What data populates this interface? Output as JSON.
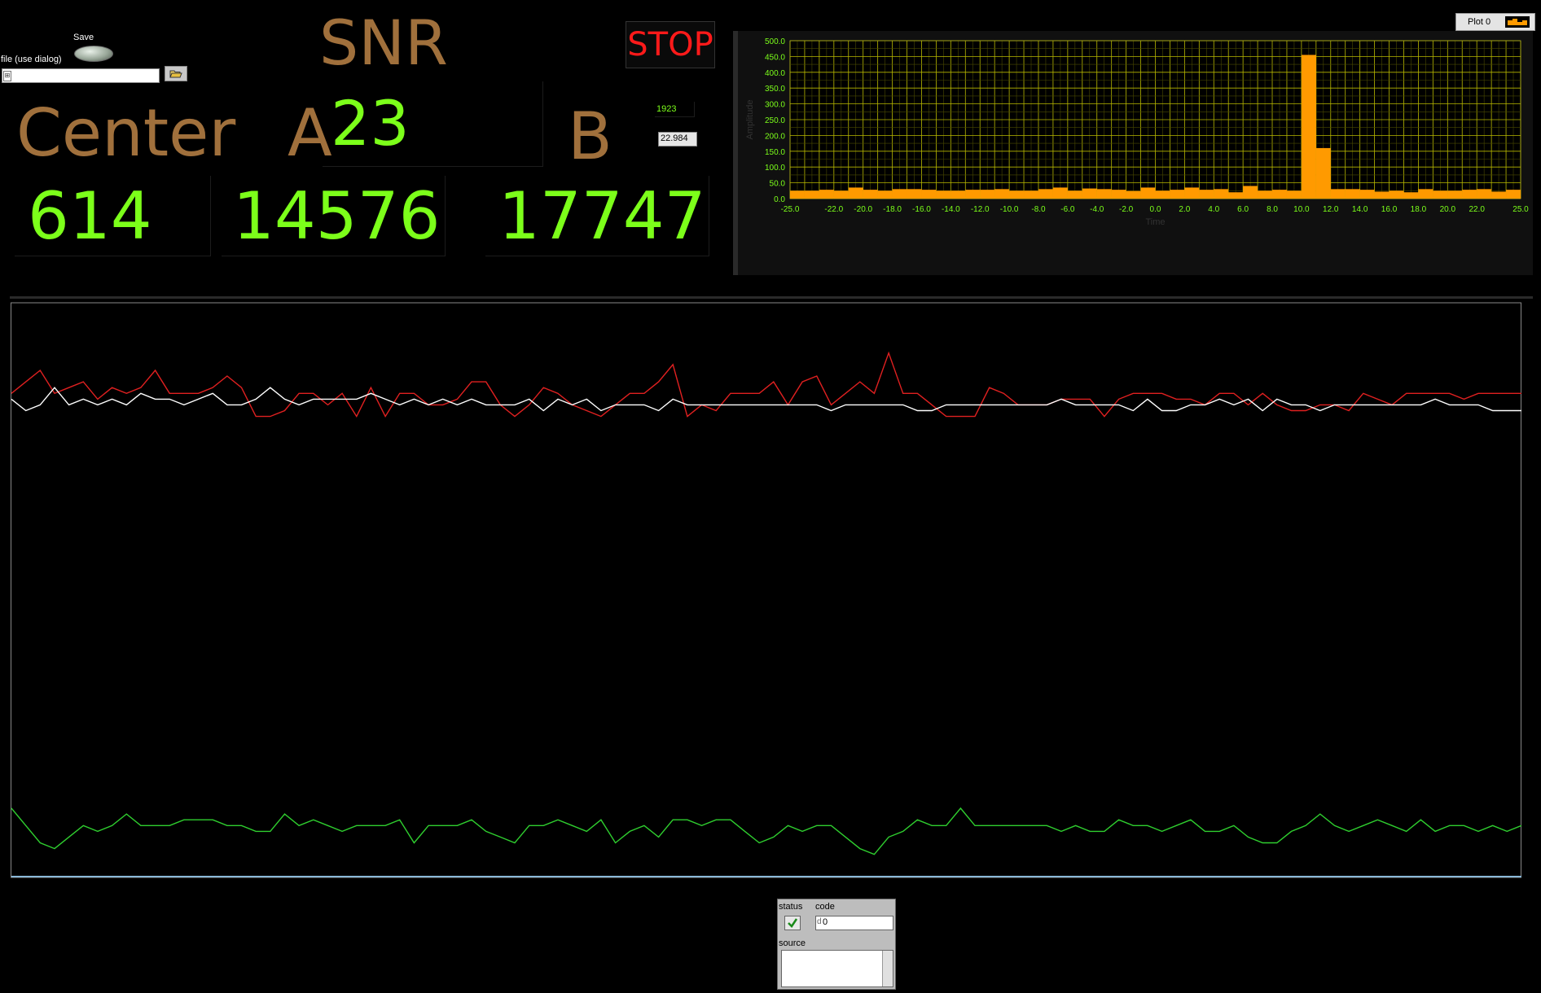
{
  "save_control": {
    "label": "Save"
  },
  "file_path": {
    "label": "file (use dialog)",
    "value": "",
    "path_prefix_icon": "path-icon",
    "browse_icon": "folder-open-icon"
  },
  "headings": {
    "snr": "SNR",
    "center": "Center",
    "a": "A",
    "b": "B"
  },
  "stop_button": {
    "label": "STOP",
    "color": "#ff1a1a"
  },
  "indicators": {
    "snr_value": "23",
    "small_value_1": "1923",
    "small_value_2": "22.984",
    "center_value": "614",
    "a_value": "14576",
    "b_value": "17747"
  },
  "colors": {
    "brown": "#a0703c",
    "green": "#7cff1a",
    "bars": "#ff9a00",
    "grid": "#b8b800"
  },
  "histogram": {
    "legend_label": "Plot 0",
    "xlabel": "Time",
    "ylabel": "Amplitude",
    "chart_data": {
      "type": "bar",
      "xlim": [
        -25,
        25
      ],
      "ylim": [
        0,
        500
      ],
      "bin_width": 1,
      "x_ticks": [
        "-25.0",
        "-22.0",
        "-20.0",
        "-18.0",
        "-16.0",
        "-14.0",
        "-12.0",
        "-10.0",
        "-8.0",
        "-6.0",
        "-4.0",
        "-2.0",
        "0.0",
        "2.0",
        "4.0",
        "6.0",
        "8.0",
        "10.0",
        "12.0",
        "14.0",
        "16.0",
        "18.0",
        "20.0",
        "22.0",
        "25.0"
      ],
      "y_ticks": [
        "0.0",
        "50.0",
        "100.0",
        "150.0",
        "200.0",
        "250.0",
        "300.0",
        "350.0",
        "400.0",
        "450.0",
        "500.0"
      ],
      "x_start": [
        -25,
        -24,
        -23,
        -22,
        -21,
        -20,
        -19,
        -18,
        -17,
        -16,
        -15,
        -14,
        -13,
        -12,
        -11,
        -10,
        -9,
        -8,
        -7,
        -6,
        -5,
        -4,
        -3,
        -2,
        -1,
        0,
        1,
        2,
        3,
        4,
        5,
        6,
        7,
        8,
        9,
        10,
        11,
        12,
        13,
        14,
        15,
        16,
        17,
        18,
        19,
        20,
        21,
        22,
        23,
        24
      ],
      "values": [
        25,
        25,
        28,
        25,
        35,
        28,
        25,
        30,
        30,
        28,
        25,
        25,
        28,
        28,
        30,
        25,
        25,
        30,
        35,
        25,
        32,
        30,
        28,
        24,
        35,
        25,
        28,
        35,
        28,
        30,
        20,
        40,
        25,
        28,
        25,
        455,
        160,
        30,
        30,
        28,
        22,
        25,
        20,
        30,
        25,
        25,
        28,
        30,
        22,
        28
      ]
    }
  },
  "waveform": {
    "chart_data": {
      "type": "line",
      "points": 106,
      "series": [
        {
          "color": "#e02020",
          "values": [
            16,
            14,
            12,
            16,
            15,
            14,
            17,
            15,
            16,
            15,
            12,
            16,
            16,
            16,
            15,
            13,
            15,
            20,
            20,
            19,
            16,
            16,
            18,
            16,
            20,
            15,
            20,
            16,
            16,
            18,
            18,
            17,
            14,
            14,
            18,
            20,
            18,
            15,
            16,
            18,
            19,
            20,
            18,
            16,
            16,
            14,
            11,
            20,
            18,
            19,
            16,
            16,
            16,
            14,
            18,
            14,
            13,
            18,
            16,
            14,
            16,
            9,
            16,
            16,
            18,
            20,
            20,
            20,
            15,
            16,
            18,
            18,
            18,
            17,
            17,
            17,
            20,
            17,
            16,
            16,
            16,
            17,
            17,
            18,
            16,
            16,
            18,
            16,
            18,
            19,
            19,
            18,
            18,
            19,
            16,
            17,
            18,
            16,
            16,
            16,
            16,
            17,
            16,
            16,
            16,
            16
          ]
        },
        {
          "color": "#ffffff",
          "values": [
            17,
            19,
            18,
            15,
            18,
            17,
            18,
            17,
            18,
            16,
            17,
            17,
            18,
            17,
            16,
            18,
            18,
            17,
            15,
            17,
            18,
            17,
            17,
            17,
            17,
            16,
            17,
            18,
            17,
            18,
            17,
            18,
            17,
            18,
            18,
            18,
            17,
            19,
            17,
            18,
            17,
            19,
            18,
            18,
            18,
            19,
            17,
            18,
            18,
            18,
            18,
            18,
            18,
            18,
            18,
            18,
            18,
            19,
            18,
            18,
            18,
            18,
            18,
            19,
            19,
            18,
            18,
            18,
            18,
            18,
            18,
            18,
            18,
            17,
            18,
            18,
            18,
            18,
            19,
            17,
            19,
            19,
            18,
            18,
            17,
            18,
            17,
            19,
            17,
            18,
            18,
            19,
            18,
            18,
            18,
            18,
            18,
            18,
            18,
            17,
            18,
            18,
            18,
            19,
            19,
            19
          ]
        },
        {
          "color": "#2fcf2f",
          "values": [
            88,
            91,
            94,
            95,
            93,
            91,
            92,
            91,
            89,
            91,
            91,
            91,
            90,
            90,
            90,
            91,
            91,
            92,
            92,
            89,
            91,
            90,
            91,
            92,
            91,
            91,
            91,
            90,
            94,
            91,
            91,
            91,
            90,
            92,
            93,
            94,
            91,
            91,
            90,
            91,
            92,
            90,
            94,
            92,
            91,
            93,
            90,
            90,
            91,
            90,
            90,
            92,
            94,
            93,
            91,
            92,
            91,
            91,
            93,
            95,
            96,
            93,
            92,
            90,
            91,
            91,
            88,
            91,
            91,
            91,
            91,
            91,
            91,
            92,
            91,
            92,
            92,
            90,
            91,
            91,
            92,
            91,
            90,
            92,
            92,
            91,
            93,
            94,
            94,
            92,
            91,
            89,
            91,
            92,
            91,
            90,
            91,
            92,
            90,
            92,
            91,
            91,
            92,
            91,
            92,
            91
          ]
        }
      ],
      "ylim": [
        100,
        0
      ]
    }
  },
  "error_cluster": {
    "status_label": "status",
    "code_label": "code",
    "code_value": "0",
    "code_prefix": "d",
    "source_label": "source",
    "source_value": ""
  }
}
